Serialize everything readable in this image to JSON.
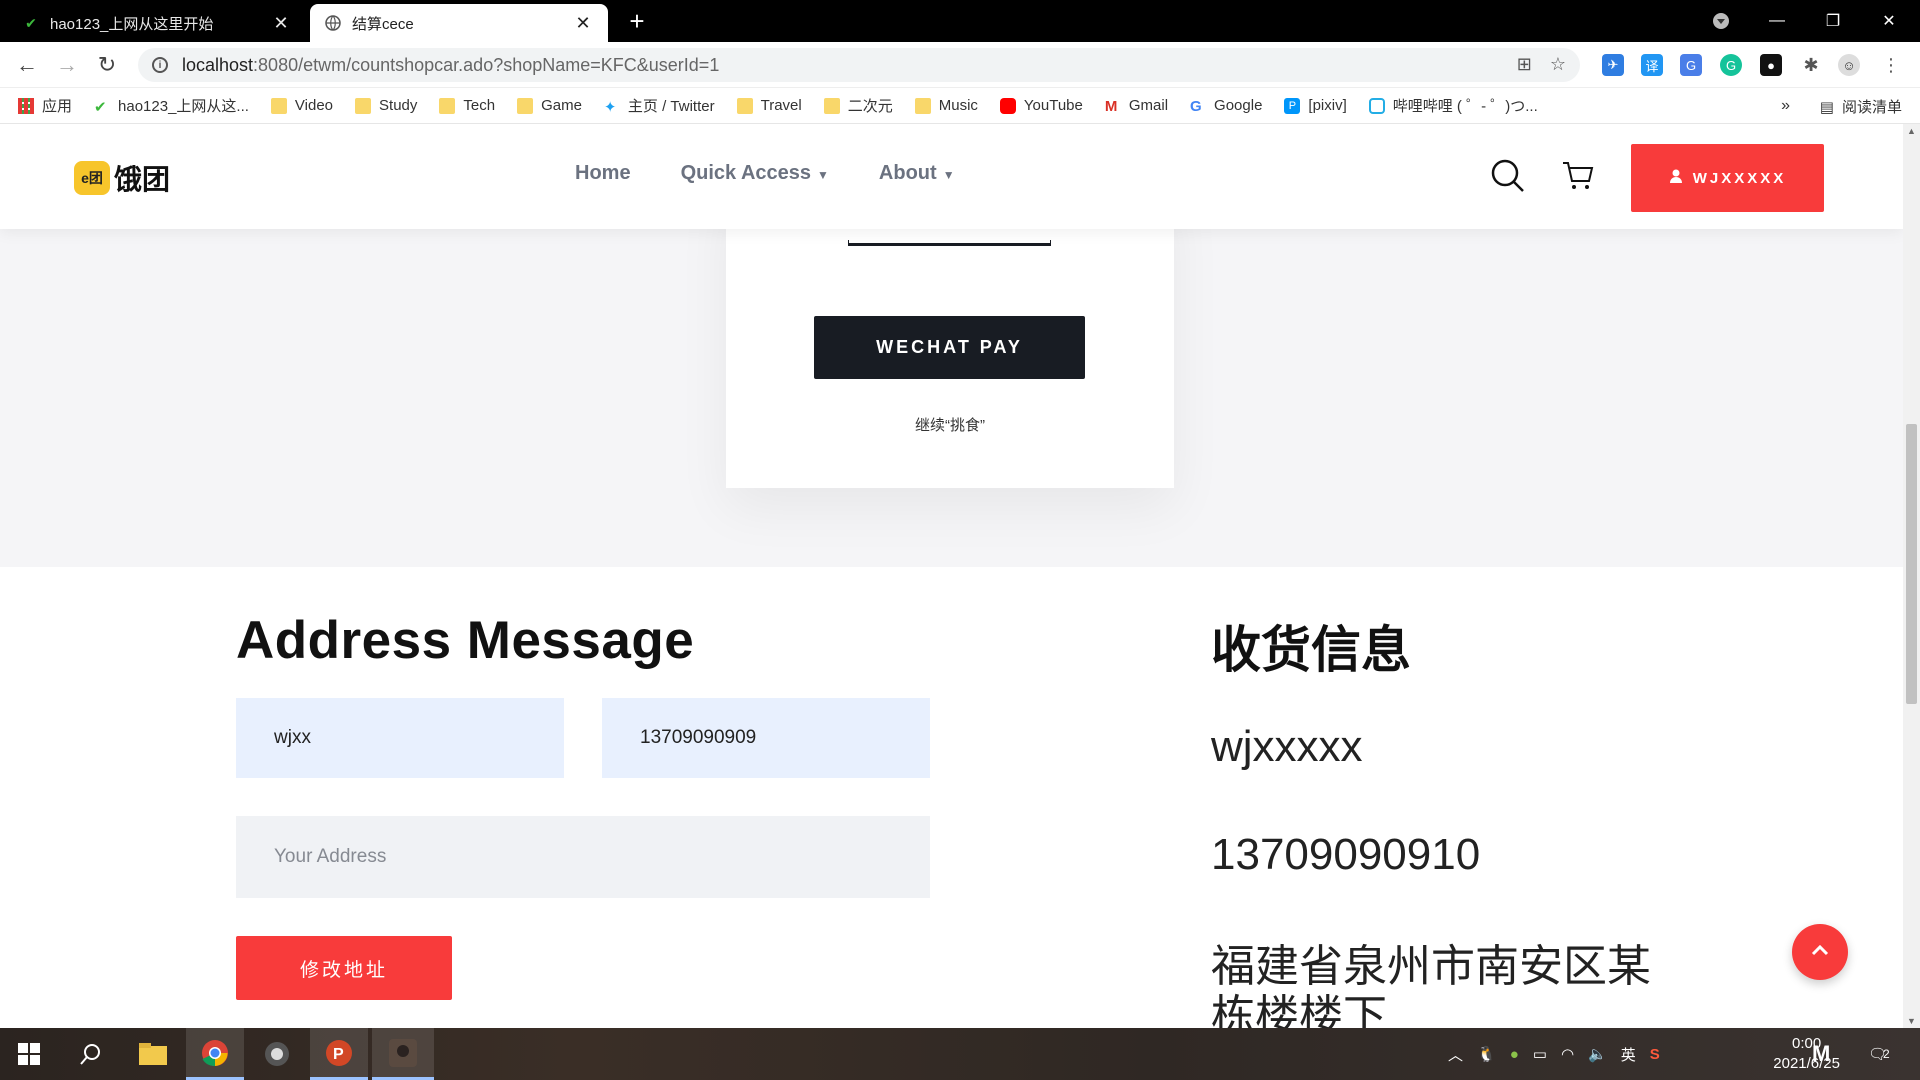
{
  "browser": {
    "tabs": [
      {
        "title": "hao123_上网从这里开始",
        "active": false
      },
      {
        "title": "结算cece",
        "active": true
      }
    ],
    "url_host": "localhost",
    "url_rest": ":8080/etwm/countshopcar.ado?shopName=KFC&userId=1",
    "bookmarks": [
      {
        "label": "应用",
        "icon": "apps-grid-icon"
      },
      {
        "label": "hao123_上网从这...",
        "icon": "hao123-icon"
      },
      {
        "label": "Video",
        "icon": "folder-icon"
      },
      {
        "label": "Study",
        "icon": "folder-icon"
      },
      {
        "label": "Tech",
        "icon": "folder-icon"
      },
      {
        "label": "Game",
        "icon": "folder-icon"
      },
      {
        "label": "主页 / Twitter",
        "icon": "twitter-icon"
      },
      {
        "label": "Travel",
        "icon": "folder-icon"
      },
      {
        "label": "二次元",
        "icon": "folder-icon"
      },
      {
        "label": "Music",
        "icon": "folder-icon"
      },
      {
        "label": "YouTube",
        "icon": "youtube-icon"
      },
      {
        "label": "Gmail",
        "icon": "gmail-icon"
      },
      {
        "label": "Google",
        "icon": "google-icon"
      },
      {
        "label": "[pixiv]",
        "icon": "pixiv-icon"
      },
      {
        "label": "哔哩哔哩 ( ゜- ゜)つ...",
        "icon": "bilibili-icon"
      }
    ],
    "bookmarks_more": "»",
    "reading_list": "阅读清单"
  },
  "site": {
    "logo_badge": "e团",
    "logo_name": "饿团",
    "nav": {
      "home": "Home",
      "quick_access": "Quick Access",
      "about": "About"
    },
    "user_button": "WJXXXXX"
  },
  "payment": {
    "wechat_pay": "WECHAT PAY",
    "continue": "继续“挑食”"
  },
  "address_form": {
    "title": "Address Message",
    "name_value": "wjxx",
    "phone_value": "13709090909",
    "address_placeholder": "Your Address",
    "modify_button": "修改地址"
  },
  "receiver": {
    "title": "收货信息",
    "name": "wjxxxxx",
    "phone": "13709090910",
    "address": "福建省泉州市南安区某栋楼楼下"
  },
  "taskbar": {
    "time": "0:00",
    "date": "2021/6/25",
    "ime": "英",
    "notifications": "2"
  },
  "colors": {
    "accent_red": "#f83b3b",
    "dark_button": "#181c23",
    "field_blue": "#e8f0fe"
  }
}
